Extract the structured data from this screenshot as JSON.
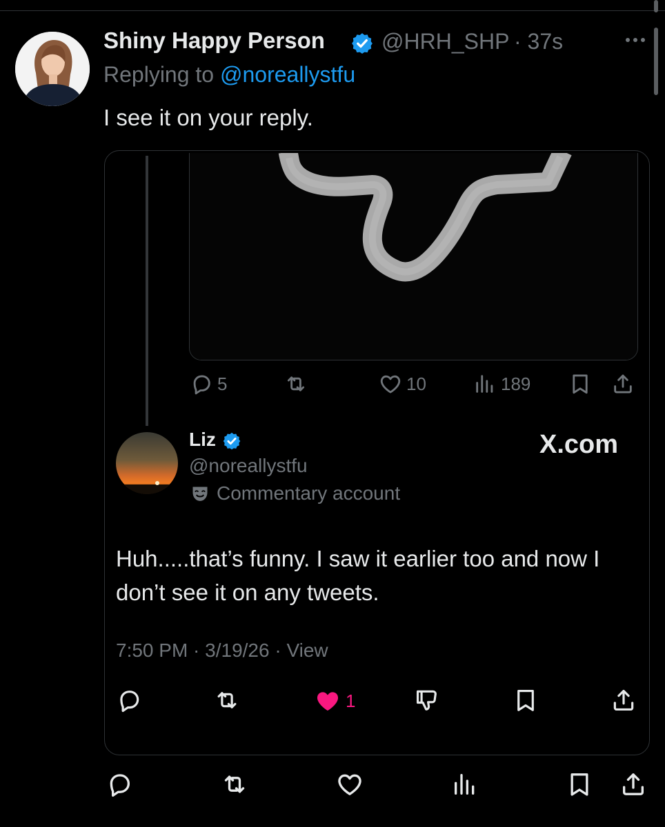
{
  "tweet": {
    "author_name": "Shiny Happy Person",
    "author_handle": "@HRH_SHP",
    "time": "· 37s",
    "replying_prefix": "Replying to ",
    "replying_to": "@noreallystfu",
    "text": "I see it on your reply."
  },
  "quoted_post_stats": {
    "replies": "5",
    "likes": "10",
    "views": "189"
  },
  "quoted_reply": {
    "author_name": "Liz",
    "author_handle": "@noreallystfu",
    "account_label": "Commentary account",
    "watermark": "X.com",
    "text": "Huh.....that’s funny. I saw it earlier too and now I don’t see it on any tweets.",
    "meta": "7:50 PM · 3/19/26 · View",
    "likes": "1"
  },
  "colors": {
    "background": "#000000",
    "text": "#e7e9ea",
    "muted": "#71767b",
    "link": "#1d9bf0",
    "verified": "#1d9bf0",
    "liked": "#f91880",
    "border": "#2f3336"
  },
  "icons": {
    "more": "more-horizontal-icon",
    "reply": "reply-bubble-icon",
    "repost": "repost-arrows-icon",
    "like": "heart-icon",
    "views": "views-bars-icon",
    "bookmark": "bookmark-icon",
    "share": "share-upload-icon",
    "downvote": "thumbs-down-icon",
    "verified": "verified-badge-icon",
    "commentary": "theater-mask-icon"
  }
}
